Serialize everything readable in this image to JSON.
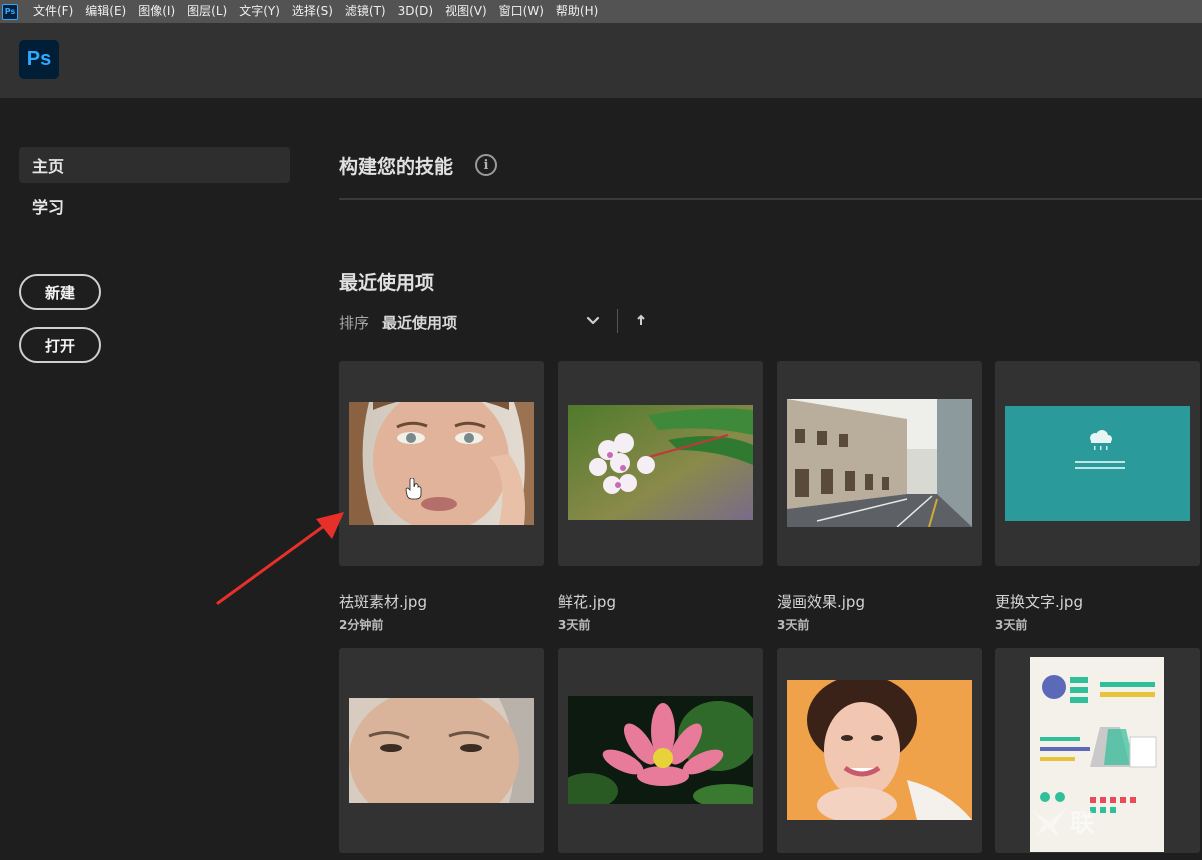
{
  "menubar": {
    "app_icon_label": "Ps",
    "items": [
      "文件(F)",
      "编辑(E)",
      "图像(I)",
      "图层(L)",
      "文字(Y)",
      "选择(S)",
      "滤镜(T)",
      "3D(D)",
      "视图(V)",
      "窗口(W)",
      "帮助(H)"
    ]
  },
  "header": {
    "logo": "Ps"
  },
  "sidebar": {
    "nav": [
      {
        "label": "主页",
        "active": true
      },
      {
        "label": "学习",
        "active": false
      }
    ],
    "new_button": "新建",
    "open_button": "打开"
  },
  "main": {
    "skills_title": "构建您的技能",
    "info_icon": "i",
    "recent_title": "最近使用项",
    "sort_label": "排序",
    "sort_value": "最近使用项",
    "recent_files": [
      {
        "name": "祛斑素材.jpg",
        "time": "2分钟前",
        "thumb": "portrait-woman"
      },
      {
        "name": "鲜花.jpg",
        "time": "3天前",
        "thumb": "flower-branch"
      },
      {
        "name": "漫画效果.jpg",
        "time": "3天前",
        "thumb": "street"
      },
      {
        "name": "更换文字.jpg",
        "time": "3天前",
        "thumb": "teal-card"
      },
      {
        "name": "",
        "time": "",
        "thumb": "older-woman"
      },
      {
        "name": "",
        "time": "",
        "thumb": "lotus"
      },
      {
        "name": "",
        "time": "",
        "thumb": "smiling-woman"
      },
      {
        "name": "",
        "time": "",
        "thumb": "infographic"
      }
    ]
  },
  "watermark": {
    "text": "联"
  },
  "colors": {
    "menubar": "#535353",
    "header": "#323232",
    "background": "#1e1e1e",
    "card": "#323232",
    "ps_blue": "#31a8ff",
    "ps_navy": "#001e36",
    "arrow": "#e8302a"
  }
}
